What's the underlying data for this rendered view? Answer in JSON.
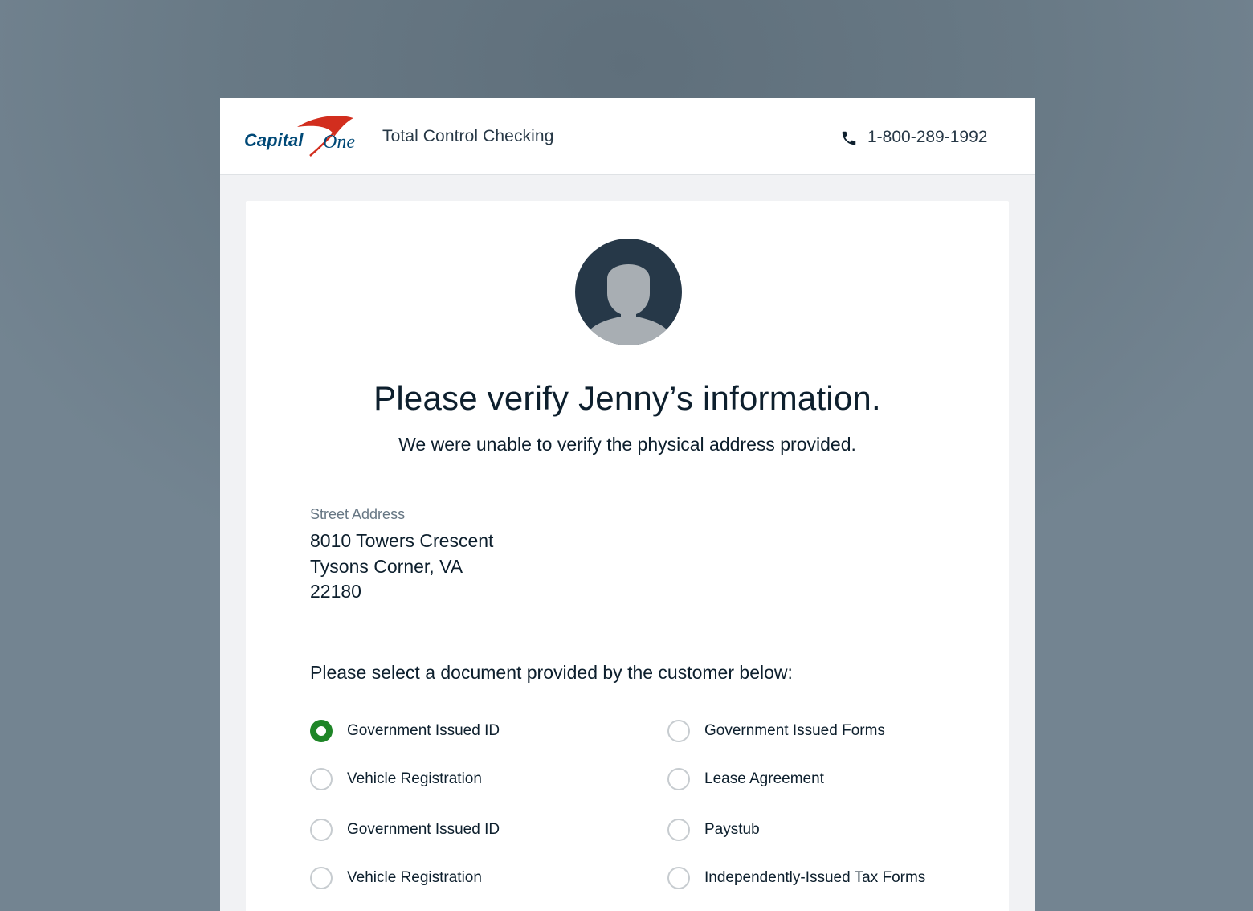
{
  "header": {
    "brand": "Capital One",
    "brand_text_primary": "Capital",
    "brand_text_secondary": "One",
    "product": "Total Control Checking",
    "phone_icon": "phone-icon",
    "phone": "1-800-289-1992"
  },
  "profile": {
    "avatar_icon": "person-silhouette-icon"
  },
  "main": {
    "title": "Please verify Jenny’s information.",
    "subtitle": "We were unable to verify the physical address provided."
  },
  "address": {
    "label": "Street Address",
    "line1": "8010 Towers Crescent",
    "line2": "Tysons Corner, VA",
    "line3": "22180"
  },
  "documents": {
    "prompt": "Please select a document provided by the customer below:",
    "selected_index": 0,
    "options": [
      {
        "label": "Government Issued ID",
        "checked": true
      },
      {
        "label": "Government Issued Forms",
        "checked": false
      },
      {
        "label": "Vehicle Registration",
        "checked": false
      },
      {
        "label": "Lease Agreement",
        "checked": false
      },
      {
        "label": "Government Issued ID",
        "checked": false
      },
      {
        "label": "Paystub",
        "checked": false
      },
      {
        "label": "Vehicle Registration",
        "checked": false
      },
      {
        "label": "Independently-Issued Tax Forms",
        "checked": false
      }
    ]
  },
  "colors": {
    "accent_green": "#1e8527",
    "brand_navy": "#004977",
    "brand_red": "#d22e1e",
    "avatar_bg": "#263848",
    "avatar_figure": "#a8aeb3"
  }
}
